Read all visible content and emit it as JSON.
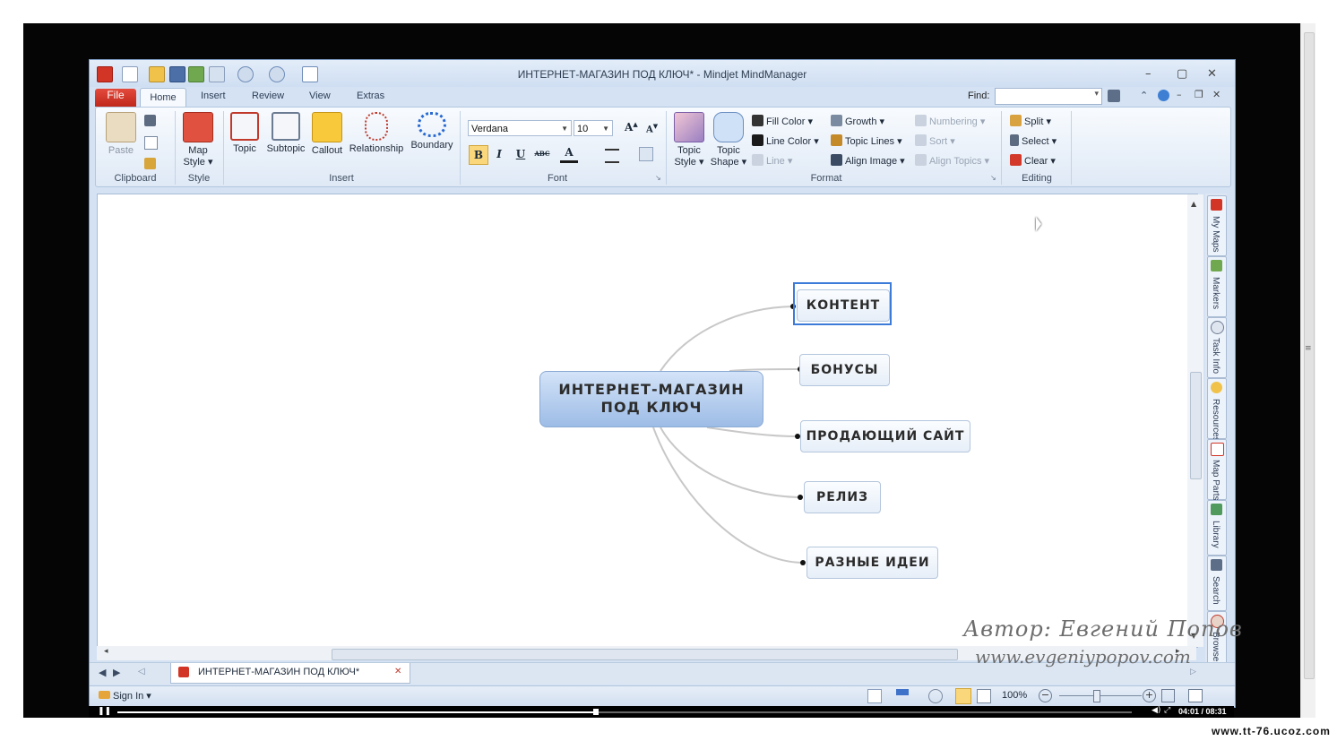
{
  "window": {
    "title": "ИНТЕРНЕТ-МАГАЗИН ПОД КЛЮЧ* - Mindjet MindManager",
    "min": "–",
    "max": "▢",
    "close": "✕"
  },
  "tabs": {
    "file": "File",
    "home": "Home",
    "insert": "Insert",
    "review": "Review",
    "view": "View",
    "extras": "Extras"
  },
  "find": {
    "label": "Find:",
    "value": ""
  },
  "ribbon": {
    "clipboard": {
      "paste": "Paste",
      "label": "Clipboard"
    },
    "style": {
      "map_style_1": "Map",
      "map_style_2": "Style ▾",
      "label": "Style"
    },
    "insert": {
      "topic": "Topic",
      "subtopic": "Subtopic",
      "callout": "Callout",
      "relationship": "Relationship",
      "boundary": "Boundary",
      "label": "Insert"
    },
    "font": {
      "family": "Verdana",
      "size": "10",
      "bold": "B",
      "italic": "I",
      "underline": "U",
      "strike": "ABC",
      "color": "A",
      "grow": "A",
      "shrink": "A",
      "label": "Font"
    },
    "format": {
      "topic_style_1": "Topic",
      "topic_style_2": "Style ▾",
      "topic_shape_1": "Topic",
      "topic_shape_2": "Shape ▾",
      "fill_color": "Fill Color ▾",
      "line_color": "Line Color ▾",
      "line": "Line ▾",
      "growth": "Growth ▾",
      "topic_lines": "Topic Lines ▾",
      "align_image": "Align Image ▾",
      "numbering": "Numbering ▾",
      "sort": "Sort ▾",
      "align_topics": "Align Topics ▾",
      "label": "Format"
    },
    "editing": {
      "split": "Split ▾",
      "select": "Select ▾",
      "clear": "Clear ▾",
      "label": "Editing"
    }
  },
  "map": {
    "central": {
      "line1": "ИНТЕРНЕТ-МАГАЗИН",
      "line2": "ПОД КЛЮЧ"
    },
    "topics": [
      "КОНТЕНТ",
      "БОНУСЫ",
      "ПРОДАЮЩИЙ САЙТ",
      "РЕЛИЗ",
      "РАЗНЫЕ ИДЕИ"
    ]
  },
  "panes": [
    "My Maps",
    "Markers",
    "Task Info",
    "Resources",
    "Map Parts",
    "Library",
    "Search",
    "Browser"
  ],
  "doc_tab": {
    "name": "ИНТЕРНЕТ-МАГАЗИН ПОД КЛЮЧ*",
    "close": "✕"
  },
  "status": {
    "sign_in": "Sign In ▾",
    "zoom": "100%"
  },
  "player": {
    "time": "04:01 / 08:31"
  },
  "watermark": {
    "author": "Автор: Евгений Попов",
    "site": "www.evgeniypopov.com",
    "corner": "www.tt-76.ucoz.com"
  },
  "colors": {
    "accent": "#2b579a",
    "file_tab": "#d23426",
    "central_topic": "#a8c4ea",
    "selection": "#3d7bd9"
  }
}
